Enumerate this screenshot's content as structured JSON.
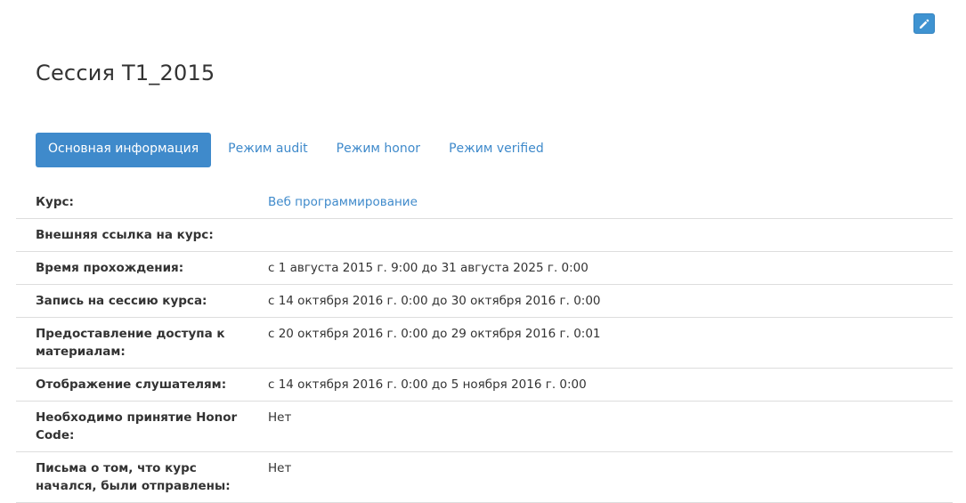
{
  "header": {
    "edit_icon": "pencil-icon",
    "title": "Сессия T1_2015"
  },
  "tabs": [
    {
      "label": "Основная информация",
      "active": true
    },
    {
      "label": "Режим audit",
      "active": false
    },
    {
      "label": "Режим honor",
      "active": false
    },
    {
      "label": "Режим verified",
      "active": false
    }
  ],
  "rows": [
    {
      "label": "Курс:",
      "value": "Веб программирование",
      "is_link": true
    },
    {
      "label": "Внешняя ссылка на курс:",
      "value": ""
    },
    {
      "label": "Время прохождения:",
      "value": "с 1 августа 2015 г. 9:00 до 31 августа 2025 г. 0:00"
    },
    {
      "label": "Запись на сессию курса:",
      "value": "с 14 октября 2016 г. 0:00 до 30 октября 2016 г. 0:00"
    },
    {
      "label": "Предоставление доступа к материалам:",
      "value": "с 20 октября 2016 г. 0:00 до 29 октября 2016 г. 0:01"
    },
    {
      "label": "Отображение слушателям:",
      "value": "с 14 октября 2016 г. 0:00 до 5 ноября 2016 г. 0:00"
    },
    {
      "label": "Необходимо принятие Honor Code:",
      "value": "Нет"
    },
    {
      "label": "Письма о том, что курс начался, были отправлены:",
      "value": "Нет"
    }
  ],
  "colors": {
    "accent": "#3f8acb",
    "edit_button": "#3f93d1"
  }
}
